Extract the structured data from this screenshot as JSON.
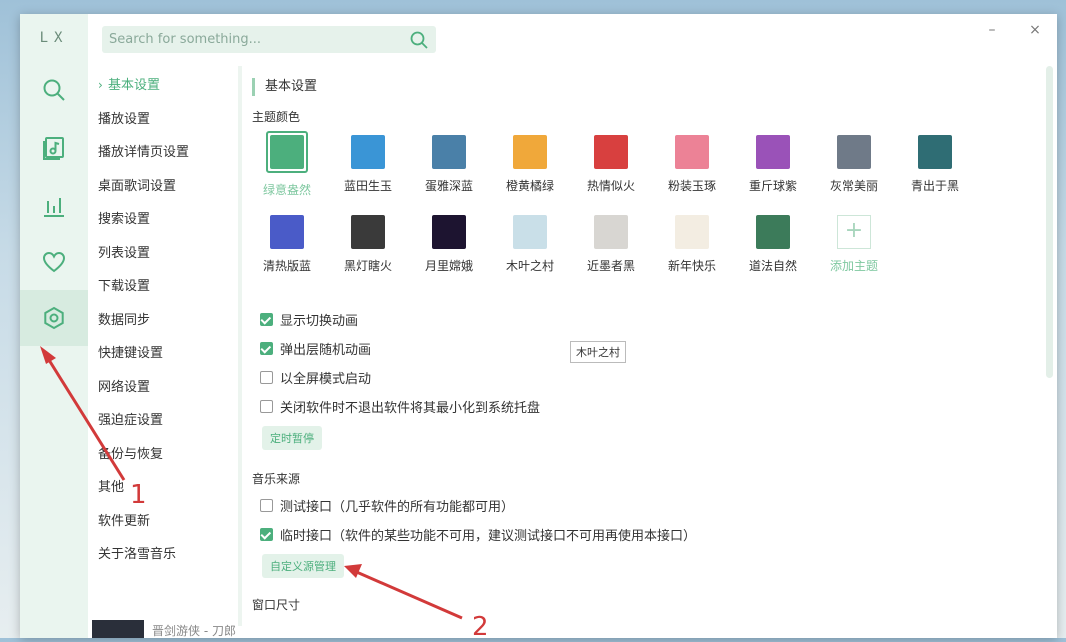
{
  "app": {
    "logo": "LX"
  },
  "search": {
    "placeholder": "Search for something..."
  },
  "window_controls": {
    "minimize": "–",
    "close": "×"
  },
  "rail": [
    {
      "name": "search",
      "icon": "search-icon"
    },
    {
      "name": "songlist",
      "icon": "music-list-icon"
    },
    {
      "name": "leaderboard",
      "icon": "chart-icon"
    },
    {
      "name": "favorites",
      "icon": "heart-icon"
    },
    {
      "name": "settings",
      "icon": "gear-icon",
      "active": true
    }
  ],
  "submenu": {
    "items": [
      "基本设置",
      "播放设置",
      "播放详情页设置",
      "桌面歌词设置",
      "搜索设置",
      "列表设置",
      "下载设置",
      "数据同步",
      "快捷键设置",
      "网络设置",
      "强迫症设置",
      "备份与恢复",
      "其他",
      "软件更新",
      "关于洛雪音乐"
    ],
    "active_index": 0
  },
  "content": {
    "section_title": "基本设置",
    "theme_label": "主题颜色",
    "themes": [
      {
        "name": "绿意盎然",
        "color": "#4caf7d",
        "selected": true
      },
      {
        "name": "蓝田生玉",
        "color": "#3a95d6"
      },
      {
        "name": "蛋雅深蓝",
        "color": "#4a80a8"
      },
      {
        "name": "橙黄橘绿",
        "color": "#f0a83a"
      },
      {
        "name": "热情似火",
        "color": "#d8403f"
      },
      {
        "name": "粉装玉琢",
        "color": "#ec8296"
      },
      {
        "name": "重斤球紫",
        "color": "#9a52b8"
      },
      {
        "name": "灰常美丽",
        "color": "#6f7a88"
      },
      {
        "name": "青出于黑",
        "color": "#2f6d74"
      },
      {
        "name": "清热版蓝",
        "color": "#4a5bc8"
      },
      {
        "name": "黑灯瞎火",
        "color": "#3a3a3a"
      },
      {
        "name": "月里嫦娥",
        "color": "#1d1430"
      },
      {
        "name": "木叶之村",
        "color": "#c9dfe8"
      },
      {
        "name": "近墨者黑",
        "color": "#d8d6d2"
      },
      {
        "name": "新年快乐",
        "color": "#f3ede2"
      },
      {
        "name": "道法自然",
        "color": "#3c7b5a"
      },
      {
        "name": "添加主题",
        "add": true
      }
    ],
    "tooltip": "木叶之村",
    "checkboxes": [
      {
        "label": "显示切换动画",
        "checked": true
      },
      {
        "label": "弹出层随机动画",
        "checked": true
      },
      {
        "label": "以全屏模式启动",
        "checked": false
      },
      {
        "label": "关闭软件时不退出软件将其最小化到系统托盘",
        "checked": false
      }
    ],
    "timer_button": "定时暂停",
    "source_label": "音乐来源",
    "sources": [
      {
        "label": "测试接口（几乎软件的所有功能都可用）",
        "checked": false
      },
      {
        "label": "临时接口（软件的某些功能不可用，建议测试接口不可用再使用本接口）",
        "checked": true
      }
    ],
    "custom_source_button": "自定义源管理",
    "window_size_label": "窗口尺寸"
  },
  "player": {
    "text": "晋剑游侠 - 刀郎"
  },
  "annotations": {
    "label_1": "1",
    "label_2": "2",
    "color": "#d23a3a"
  }
}
